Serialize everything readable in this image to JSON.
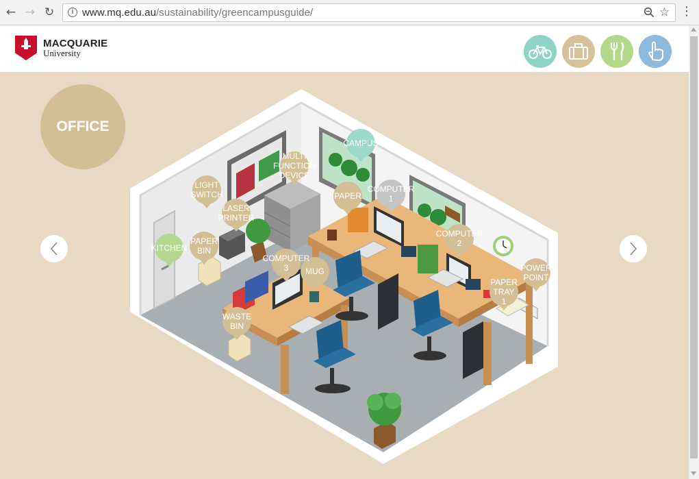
{
  "browser": {
    "url_host": "www.mq.edu.au",
    "url_path": "/sustainability/greencampusguide/"
  },
  "header": {
    "logo_line1": "MACQUARIE",
    "logo_line2": "University",
    "categories": [
      {
        "icon": "bicycle-icon",
        "color": "#8fd3c7"
      },
      {
        "icon": "briefcase-icon",
        "color": "#d5c29b"
      },
      {
        "icon": "cutlery-icon",
        "color": "#b4d88a"
      },
      {
        "icon": "hand-pointer-icon",
        "color": "#8eb9da"
      }
    ]
  },
  "room": {
    "title": "OFFICE"
  },
  "hotspots": [
    {
      "label": "CAMPUS",
      "color": "#9ed8c9"
    },
    {
      "label": "MULTI\nFUNCTION\nDEVICE",
      "color": "#d3bf95"
    },
    {
      "label": "LIGHT\nSWITCH",
      "color": "#d3bf95"
    },
    {
      "label": "PAPER",
      "color": "#d3bf95"
    },
    {
      "label": "COMPUTER\n1",
      "color": "#c4c4c4"
    },
    {
      "label": "LASER\nPRINTER",
      "color": "#d3bf95"
    },
    {
      "label": "COMPUTER\n2",
      "color": "#d3bf95"
    },
    {
      "label": "PAPER\nBIN",
      "color": "#d3bf95"
    },
    {
      "label": "KITCHEN",
      "color": "#b5d890"
    },
    {
      "label": "COMPUTER\n3",
      "color": "#d3bf95"
    },
    {
      "label": "MUG",
      "color": "#d3bf95"
    },
    {
      "label": "POWER\nPOINT",
      "color": "#d3bf95"
    },
    {
      "label": "PAPER\nTRAY\n1",
      "color": "#d3bf95"
    },
    {
      "label": "WASTE\nBIN",
      "color": "#d3bf95"
    }
  ]
}
